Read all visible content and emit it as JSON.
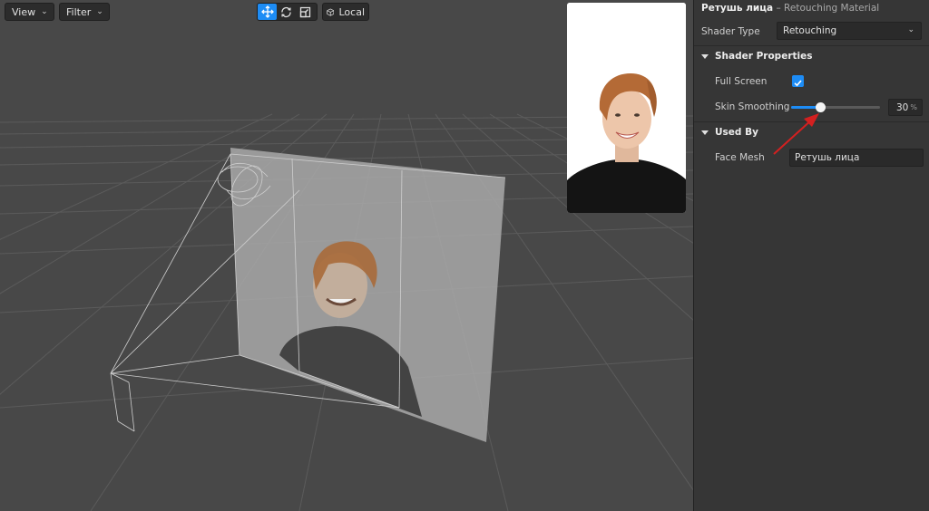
{
  "toolbar": {
    "view_label": "View",
    "filter_label": "Filter",
    "local_label": "Local",
    "tools": [
      "move-icon",
      "rotate-icon",
      "scale-icon"
    ],
    "active_tool": "move-icon",
    "accent": "#1d8cf5"
  },
  "inspector": {
    "material_name": "Ретушь лица",
    "material_type": "– Retouching Material",
    "shader_type_label": "Shader Type",
    "shader_type_value": "Retouching",
    "shader_properties_label": "Shader Properties",
    "full_screen_label": "Full Screen",
    "full_screen_checked": true,
    "skin_smoothing_label": "Skin Smoothing",
    "skin_smoothing_value": "30",
    "skin_smoothing_unit": "%",
    "skin_smoothing_slider_fraction": 0.33,
    "used_by_label": "Used By",
    "face_mesh_label": "Face Mesh",
    "face_mesh_value": "Ретушь лица"
  },
  "annotation": {
    "arrow_color": "#d42020"
  }
}
